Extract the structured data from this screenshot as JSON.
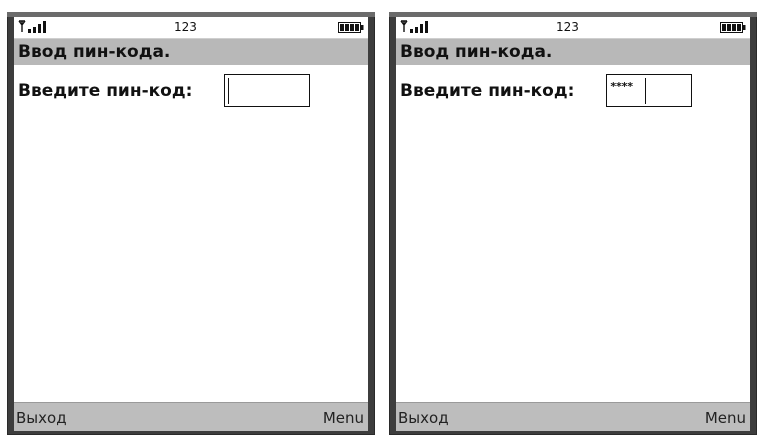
{
  "colors": {
    "bezel": "#3d3d3d",
    "title_bar": "#b8b8b8",
    "softkey_bar": "#bdbdbd",
    "screen": "#ffffff",
    "text": "#111111"
  },
  "status": {
    "signal_icon": "antenna-signal-icon",
    "clock_text": "123",
    "battery_icon": "battery-icon"
  },
  "phones": [
    {
      "title": "Ввод пин-кода.",
      "field_label": "Введите пин-код:",
      "pin_value": "",
      "softkeys": {
        "left": "Выход",
        "right": "Menu"
      }
    },
    {
      "title": "Ввод пин-кода.",
      "field_label": "Введите пин-код:",
      "pin_value": "****",
      "softkeys": {
        "left": "Выход",
        "right": "Menu"
      }
    }
  ]
}
